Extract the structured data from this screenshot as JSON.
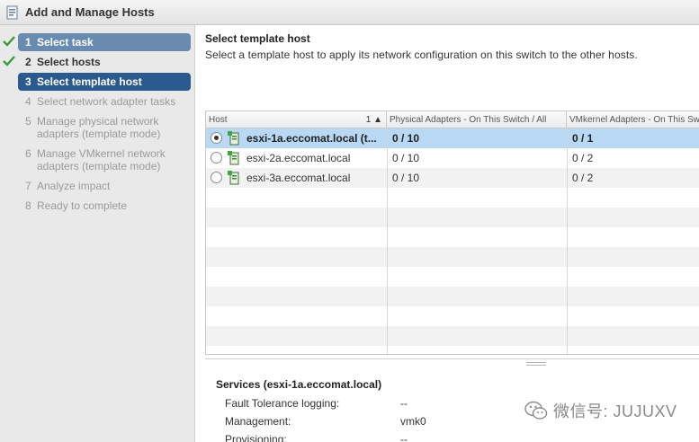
{
  "window": {
    "title": "Add and Manage Hosts"
  },
  "steps": [
    {
      "num": "1",
      "label": "Select task"
    },
    {
      "num": "2",
      "label": "Select hosts"
    },
    {
      "num": "3",
      "label": "Select template host"
    },
    {
      "num": "4",
      "label": "Select network adapter tasks"
    },
    {
      "num": "5",
      "label": "Manage physical network adapters (template mode)"
    },
    {
      "num": "6",
      "label": "Manage VMkernel network adapters (template mode)"
    },
    {
      "num": "7",
      "label": "Analyze impact"
    },
    {
      "num": "8",
      "label": "Ready to complete"
    }
  ],
  "main": {
    "heading": "Select template host",
    "subheading": "Select a template host to apply its network configuration on this switch to the other hosts."
  },
  "grid": {
    "columns": [
      {
        "label": "Host",
        "sort": "1 ▲"
      },
      {
        "label": "Physical Adapters - On This Switch / All"
      },
      {
        "label": "VMkernel Adapters - On This Switch / All"
      }
    ],
    "rows": [
      {
        "host": "esxi-1a.eccomat.local (t...",
        "physical": "0 / 10",
        "vmkernel": "0 / 1",
        "selected": true
      },
      {
        "host": "esxi-2a.eccomat.local",
        "physical": "0 / 10",
        "vmkernel": "0 / 2",
        "selected": false
      },
      {
        "host": "esxi-3a.eccomat.local",
        "physical": "0 / 10",
        "vmkernel": "0 / 2",
        "selected": false
      }
    ]
  },
  "details": {
    "title": "Services (esxi-1a.eccomat.local)",
    "items": [
      {
        "label": "Fault Tolerance logging:",
        "value": "--"
      },
      {
        "label": "Management:",
        "value": "vmk0"
      },
      {
        "label": "Provisioning:",
        "value": "--"
      }
    ]
  },
  "watermark": {
    "text": "微信号: JUJUXV"
  },
  "colors": {
    "current_step": "#2b5b8e",
    "first_step": "#6a8bb0",
    "selected_row": "#b8d8f4",
    "check": "#3a9a3a"
  },
  "icons": [
    "wizard-icon",
    "checkmark-icon",
    "radio-icon",
    "host-icon",
    "wechat-icon"
  ]
}
